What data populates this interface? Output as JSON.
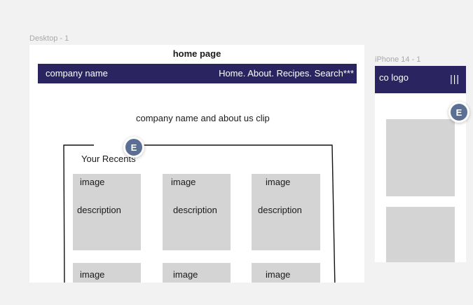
{
  "canvas": {
    "desktop_frame_label": "Desktop - 1",
    "iphone_frame_label": "iPhone 14 - 1"
  },
  "desktop": {
    "page_title": "home page",
    "navbar": {
      "company_name": "company name",
      "nav_links": "Home. About.  Recipes. Search***"
    },
    "hero_text": "company name and about us clip",
    "recents": {
      "heading": "Your Recents",
      "cards_row1": [
        {
          "image_label": "image",
          "description": "description"
        },
        {
          "image_label": "image",
          "description": "description"
        },
        {
          "image_label": "image",
          "description": "description"
        }
      ],
      "cards_row2": [
        {
          "image_label": "image"
        },
        {
          "image_label": "image"
        },
        {
          "image_label": "image"
        }
      ]
    },
    "comment_avatar": "E"
  },
  "iphone": {
    "navbar": {
      "logo": "co logo",
      "menu_icon": "|||"
    },
    "comment_avatar": "E"
  },
  "colors": {
    "navbar_bg": "#2a2461",
    "placeholder_gray": "#d4d4d4",
    "avatar_bg": "#5b6f95",
    "canvas_bg": "#f2f2f2"
  }
}
